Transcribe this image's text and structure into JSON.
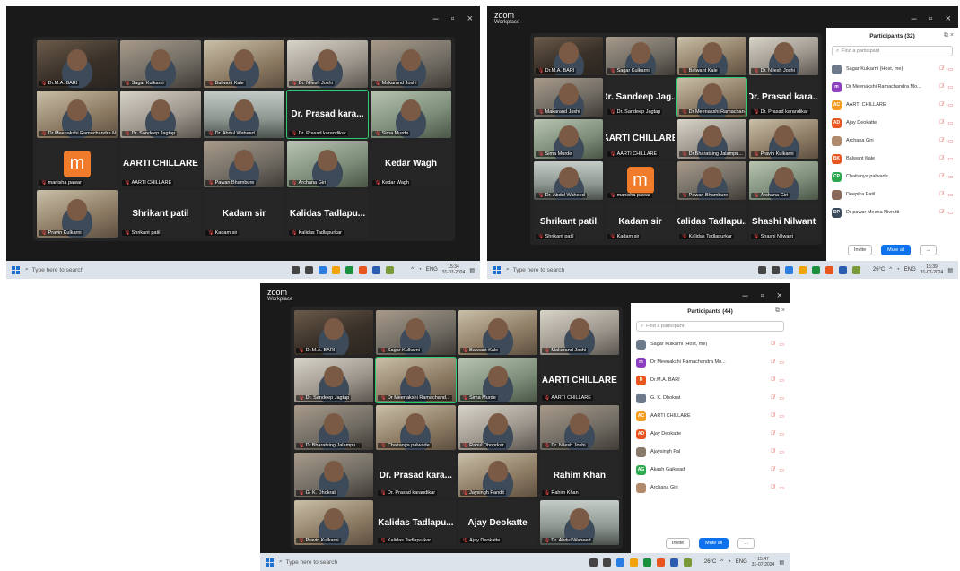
{
  "screens": [
    {
      "window": {
        "brand_top": "",
        "brand_bottom": "",
        "controls": [
          "–",
          "▫",
          "×"
        ]
      },
      "tiles": [
        {
          "name": "Dr.M.A. BARI",
          "kind": "video",
          "tone": "a"
        },
        {
          "name": "Sagar Kulkarni",
          "kind": "video",
          "tone": "c"
        },
        {
          "name": "Balwant Kale",
          "kind": "video",
          "tone": "b"
        },
        {
          "name": "Dr. Nilesh Joshi",
          "kind": "video",
          "tone": "d"
        },
        {
          "name": "Makarand Joshi",
          "kind": "video",
          "tone": "c"
        },
        {
          "name": "Dr Meenakshi Ramachandra M...",
          "kind": "video",
          "tone": "b"
        },
        {
          "name": "Dr. Sandeep Jagtap",
          "kind": "video",
          "tone": "d"
        },
        {
          "name": "Dr. Abdul Waheed",
          "kind": "video",
          "tone": "g"
        },
        {
          "name": "Dr. Prasad karandikar",
          "kind": "text",
          "big": "Dr. Prasad kara...",
          "active": true
        },
        {
          "name": "Sima Murde",
          "kind": "video",
          "tone": "e"
        },
        {
          "name": "manisha pawar",
          "kind": "logo",
          "logo": "m"
        },
        {
          "name": "AARTI CHILLARE",
          "kind": "text",
          "big": "AARTI CHILLARE"
        },
        {
          "name": "Pawan Bhambure",
          "kind": "video",
          "tone": "c"
        },
        {
          "name": "Archana Giri",
          "kind": "video",
          "tone": "e"
        },
        {
          "name": "Kedar Wagh",
          "kind": "text",
          "big": "Kedar Wagh"
        },
        {
          "name": "Pravin Kulkarni",
          "kind": "video",
          "tone": "b"
        },
        {
          "name": "Shrikant patil",
          "kind": "text",
          "big": "Shrikant patil"
        },
        {
          "name": "Kadam sir",
          "kind": "text",
          "big": "Kadam sir"
        },
        {
          "name": "Kalidas Tadlapurkar",
          "kind": "text",
          "big": "Kalidas Tadlapu..."
        }
      ],
      "taskbar": {
        "search": "Type here to search",
        "weather": "",
        "lang": "ENG",
        "time": "15:34",
        "date": "31-07-2024"
      }
    },
    {
      "window": {
        "brand_top": "zoom",
        "brand_bottom": "Workplace",
        "controls": [
          "–",
          "▫",
          "×"
        ]
      },
      "tiles": [
        {
          "name": "Dr.M.A. BARI",
          "kind": "video",
          "tone": "a"
        },
        {
          "name": "Sagar Kulkarni",
          "kind": "video",
          "tone": "c"
        },
        {
          "name": "Balwant Kale",
          "kind": "video",
          "tone": "b"
        },
        {
          "name": "Dr. Nilesh Joshi",
          "kind": "video",
          "tone": "d"
        },
        {
          "name": "Makarand Joshi",
          "kind": "video",
          "tone": "c"
        },
        {
          "name": "Dr. Sandeep Jagtap",
          "kind": "text",
          "big": "Dr. Sandeep Jag..."
        },
        {
          "name": "Dr Meenakshi Ramachand...",
          "kind": "video",
          "tone": "b",
          "active": true
        },
        {
          "name": "Dr. Prasad karandikar",
          "kind": "text",
          "big": "Dr. Prasad kara..."
        },
        {
          "name": "Sima Murde",
          "kind": "video",
          "tone": "e"
        },
        {
          "name": "AARTI CHILLARE",
          "kind": "text",
          "big": "AARTI CHILLARE"
        },
        {
          "name": "Dr.Bharatsing Jalampu...",
          "kind": "video",
          "tone": "d"
        },
        {
          "name": "Pravin Kulkarni",
          "kind": "video",
          "tone": "b"
        },
        {
          "name": "Dr. Abdul Waheed",
          "kind": "video",
          "tone": "g"
        },
        {
          "name": "manisha pawar",
          "kind": "logo",
          "logo": "m"
        },
        {
          "name": "Pawan Bhambure",
          "kind": "video",
          "tone": "c"
        },
        {
          "name": "Archana Giri",
          "kind": "video",
          "tone": "e"
        },
        {
          "name": "Shrikant patil",
          "kind": "text",
          "big": "Shrikant patil"
        },
        {
          "name": "Kadam sir",
          "kind": "text",
          "big": "Kadam sir"
        },
        {
          "name": "Kalidas Tadlapurkar",
          "kind": "text",
          "big": "Kalidas Tadlapu..."
        },
        {
          "name": "Shashi Nilwant",
          "kind": "text",
          "big": "Shashi Nilwant"
        }
      ],
      "panel": {
        "title": "Participants (32)",
        "search_placeholder": "Find a participant",
        "participants": [
          {
            "name": "Sagar Kulkarni (Host, me)",
            "initials": "",
            "color": "#6c7a8c"
          },
          {
            "name": "Dr Meenakshi Ramachandra Mo...",
            "initials": "m",
            "color": "#8e3fbf"
          },
          {
            "name": "AARTI CHILLARE",
            "initials": "AC",
            "color": "#f39c1f"
          },
          {
            "name": "Ajay Deokatte",
            "initials": "AD",
            "color": "#e8551e"
          },
          {
            "name": "Archana Giri",
            "initials": "",
            "color": "#b08a6a"
          },
          {
            "name": "Balwant Kale",
            "initials": "BK",
            "color": "#e8551e"
          },
          {
            "name": "Chaitanya palwade",
            "initials": "CP",
            "color": "#2ea84f"
          },
          {
            "name": "Deepika Patil",
            "initials": "",
            "color": "#8a6a5a"
          },
          {
            "name": "Dr pawar Meena Nivrutti",
            "initials": "DP",
            "color": "#3b4a5c"
          }
        ],
        "invite": "Invite",
        "mute_all": "Mute all",
        "more": "..."
      },
      "taskbar": {
        "search": "Type here to search",
        "weather": "26°C",
        "lang": "ENG",
        "time": "15:39",
        "date": "31-07-2024"
      }
    },
    {
      "window": {
        "brand_top": "zoom",
        "brand_bottom": "Workplace",
        "controls": [
          "–",
          "▫",
          "×"
        ]
      },
      "tiles": [
        {
          "name": "Dr.M.A. BARI",
          "kind": "video",
          "tone": "a"
        },
        {
          "name": "Sagar Kulkarni",
          "kind": "video",
          "tone": "c"
        },
        {
          "name": "Balwant Kale",
          "kind": "video",
          "tone": "b"
        },
        {
          "name": "Makarand Joshi",
          "kind": "video",
          "tone": "d"
        },
        {
          "name": "Dr. Sandeep Jagtap",
          "kind": "video",
          "tone": "d"
        },
        {
          "name": "Dr Meenakshi Ramachand...",
          "kind": "video",
          "tone": "b",
          "active": true
        },
        {
          "name": "Sima Murde",
          "kind": "video",
          "tone": "e"
        },
        {
          "name": "AARTI CHILLARE",
          "kind": "text",
          "big": "AARTI CHILLARE"
        },
        {
          "name": "Dr.Bharatsing Jalampu...",
          "kind": "video",
          "tone": "c"
        },
        {
          "name": "Chaitanya palwade",
          "kind": "video",
          "tone": "b"
        },
        {
          "name": "Rahul Dhoorkar",
          "kind": "video",
          "tone": "d"
        },
        {
          "name": "Dr. Nilesh Joshi",
          "kind": "video",
          "tone": "c"
        },
        {
          "name": "G. K. Dhokrat",
          "kind": "video",
          "tone": "c"
        },
        {
          "name": "Dr. Prasad karandikar",
          "kind": "text",
          "big": "Dr. Prasad kara..."
        },
        {
          "name": "Jaysingh Pandit",
          "kind": "video",
          "tone": "b"
        },
        {
          "name": "Rahim Khan",
          "kind": "text",
          "big": "Rahim Khan"
        },
        {
          "name": "Pravin Kulkarni",
          "kind": "video",
          "tone": "b"
        },
        {
          "name": "Kalidas Tadlapurkar",
          "kind": "text",
          "big": "Kalidas Tadlapu..."
        },
        {
          "name": "Ajay Deokatte",
          "kind": "text",
          "big": "Ajay Deokatte"
        },
        {
          "name": "Dr. Abdul Waheed",
          "kind": "video",
          "tone": "g"
        }
      ],
      "panel": {
        "title": "Participants (44)",
        "search_placeholder": "Find a participant",
        "participants": [
          {
            "name": "Sagar Kulkarni (Host, me)",
            "initials": "",
            "color": "#6c7a8c"
          },
          {
            "name": "Dr Meenakshi Ramachandra Mo...",
            "initials": "m",
            "color": "#8e3fbf"
          },
          {
            "name": "Dr.M.A. BARI",
            "initials": "D",
            "color": "#e8551e"
          },
          {
            "name": "G. K. Dhokrat",
            "initials": "",
            "color": "#6c7a8c"
          },
          {
            "name": "AARTI CHILLARE",
            "initials": "AC",
            "color": "#f39c1f"
          },
          {
            "name": "Ajay Deokatte",
            "initials": "AD",
            "color": "#e8551e"
          },
          {
            "name": "Ajaysingh Pal",
            "initials": "",
            "color": "#8a7a6a"
          },
          {
            "name": "Akash Gaikwad",
            "initials": "AG",
            "color": "#2ea84f"
          },
          {
            "name": "Archana Giri",
            "initials": "",
            "color": "#b08a6a"
          }
        ],
        "invite": "Invite",
        "mute_all": "Mute all",
        "more": "..."
      },
      "taskbar": {
        "search": "Type here to search",
        "weather": "26°C",
        "lang": "ENG",
        "time": "15:47",
        "date": "31-07-2024"
      }
    }
  ]
}
